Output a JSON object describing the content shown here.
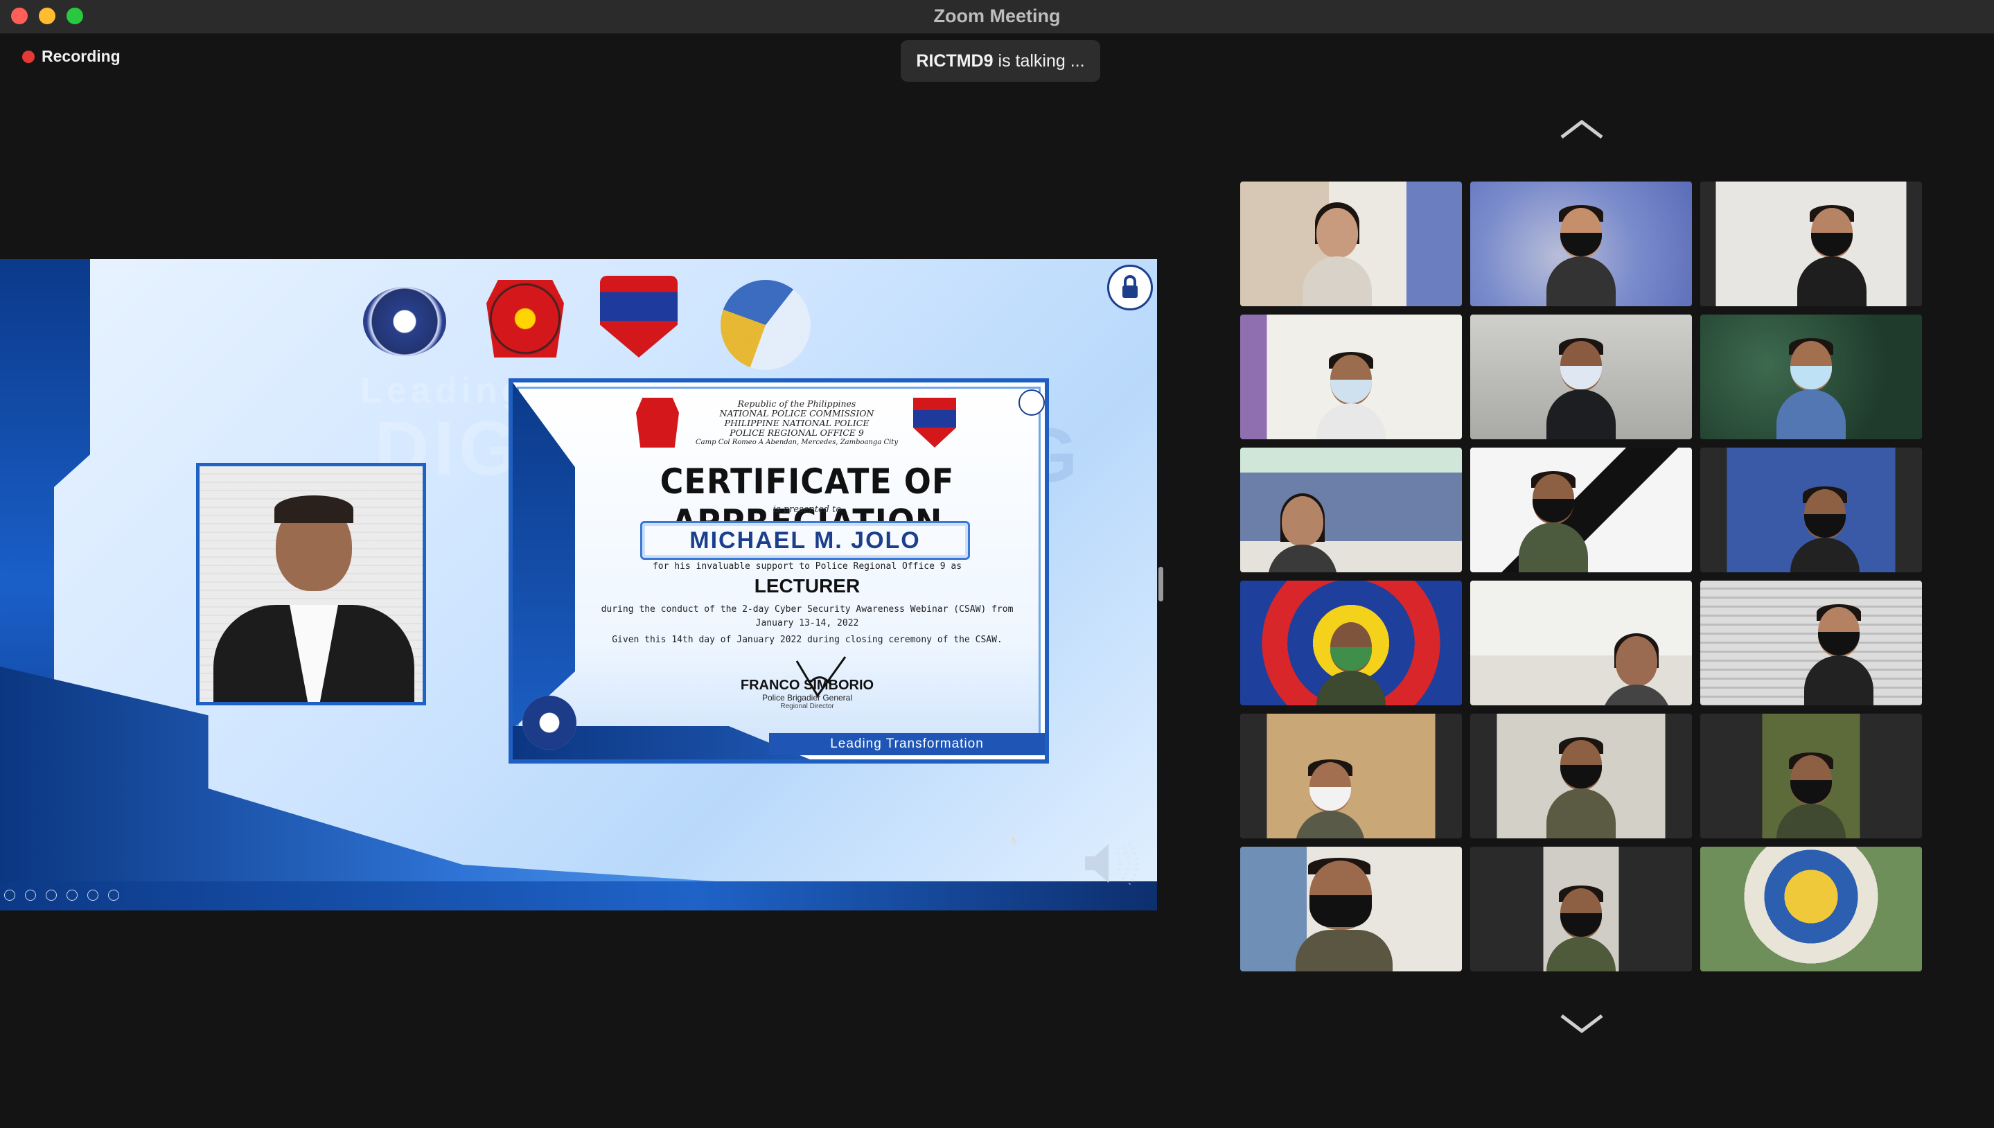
{
  "window": {
    "title": "Zoom Meeting"
  },
  "recording": {
    "label": "Recording"
  },
  "active_speaker": {
    "name": "RICTMD9",
    "suffix": "is talking ..."
  },
  "colors": {
    "recording": "#e53935",
    "background": "#141414",
    "accent": "#1e5fc1"
  },
  "shared_screen": {
    "background_word": "Leading",
    "background_word2": "DIGITAL",
    "background_word3": "ING",
    "certificate": {
      "header_lines": [
        "Republic of the Philippines",
        "NATIONAL POLICE COMMISSION",
        "PHILIPPINE NATIONAL POLICE",
        "POLICE REGIONAL OFFICE 9",
        "Camp Col Romeo A Abendan, Mercedes, Zamboanga City"
      ],
      "title": "CERTIFICATE OF APPRECIATION",
      "presented": "is presented to",
      "recipient": "MICHAEL M. JOLO",
      "support_line": "for his invaluable support to Police Regional Office 9 as",
      "role": "LECTURER",
      "conduct_line": "during the conduct of the 2-day Cyber Security Awareness Webinar (CSAW) from",
      "date_line": "January 13-14, 2022",
      "given_line": "Given this 14th day of January 2022 during closing ceremony of the CSAW.",
      "signer": "FRANCO SIMBORIO",
      "signer_rank": "Police Brigadier General",
      "signer_position": "Regional Director",
      "footer": "Leading Transformation"
    }
  },
  "gallery": {
    "tiles": [
      {
        "icon": "participant"
      },
      {
        "icon": "participant"
      },
      {
        "icon": "participant"
      },
      {
        "icon": "participant"
      },
      {
        "icon": "participant"
      },
      {
        "icon": "participant"
      },
      {
        "icon": "participant"
      },
      {
        "icon": "participant"
      },
      {
        "icon": "participant"
      },
      {
        "icon": "participant"
      },
      {
        "icon": "participant"
      },
      {
        "icon": "participant"
      },
      {
        "icon": "participant"
      },
      {
        "icon": "participant"
      },
      {
        "icon": "participant"
      },
      {
        "icon": "participant"
      },
      {
        "icon": "participant"
      },
      {
        "icon": "participant"
      }
    ],
    "scroll_up_icon": "chevron-up-icon",
    "scroll_down_icon": "chevron-down-icon"
  }
}
